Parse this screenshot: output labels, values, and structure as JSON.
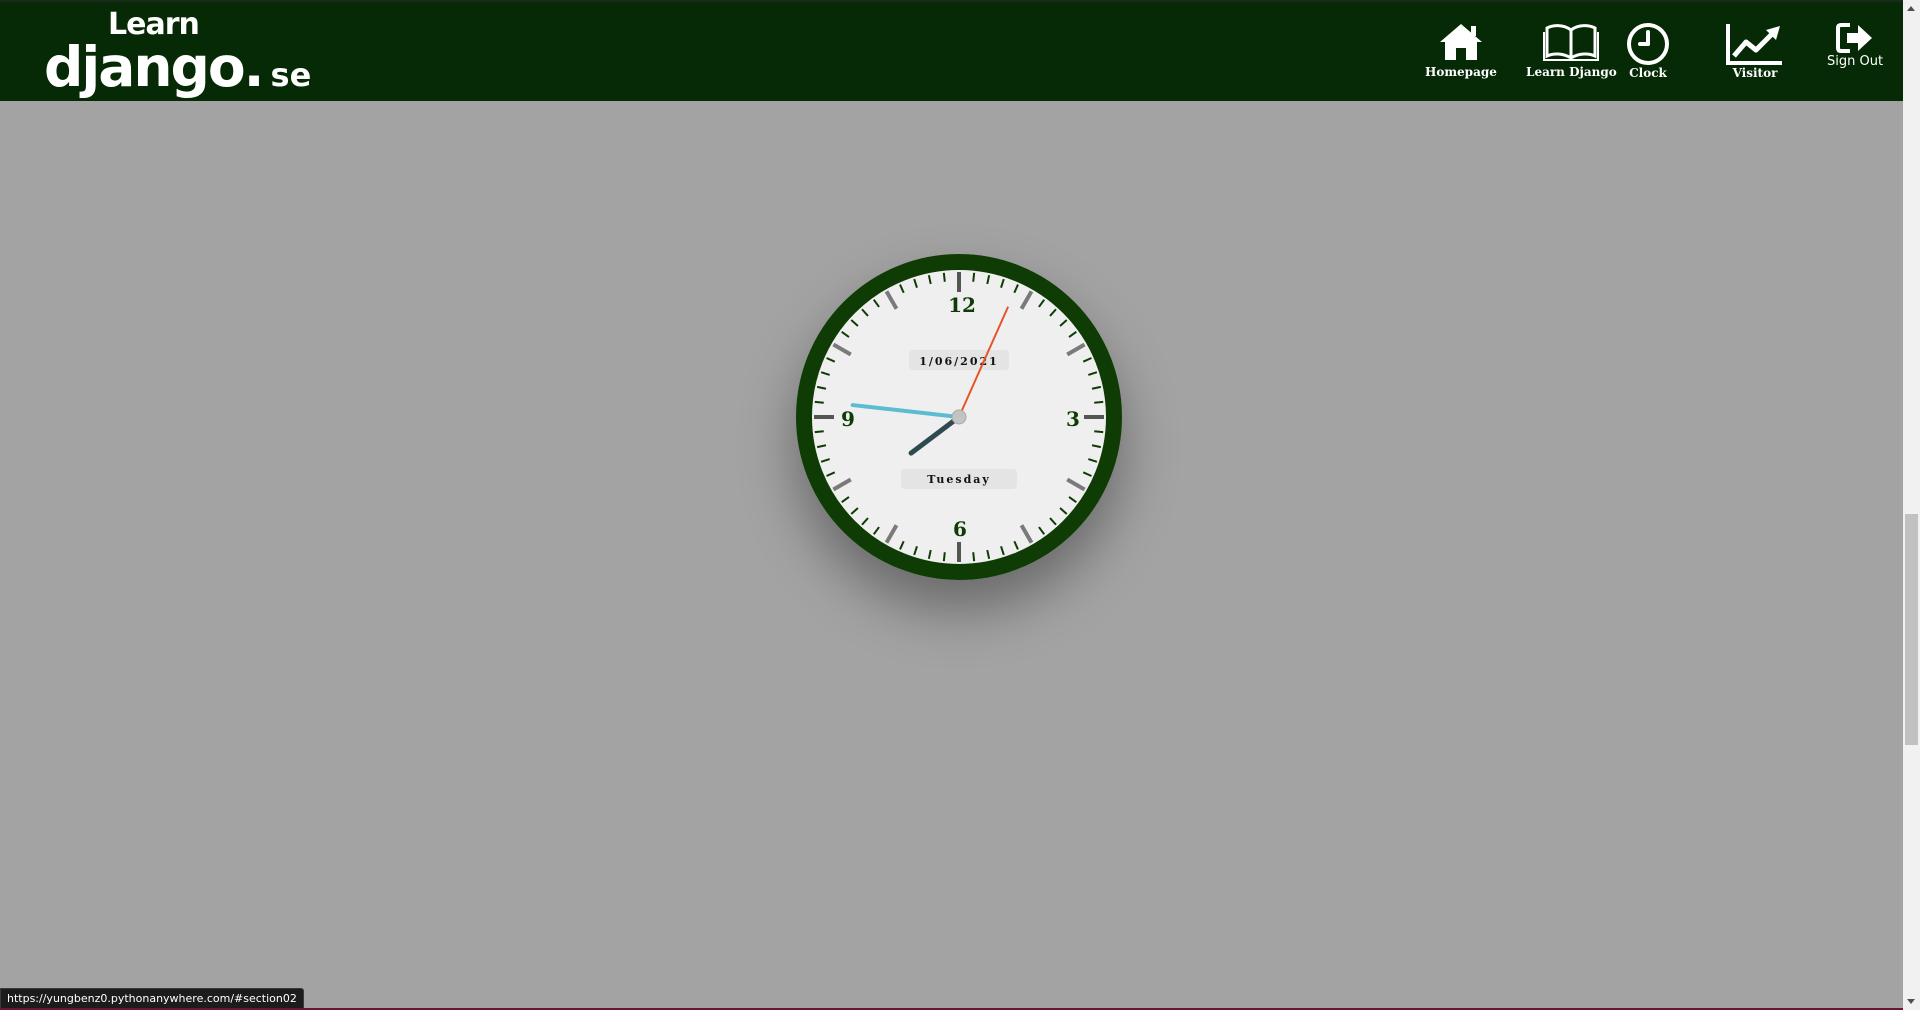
{
  "logo": {
    "line1": "Learn",
    "line2": "django.",
    "suffix": "se"
  },
  "nav": [
    {
      "label": "Homepage",
      "icon": "home-icon"
    },
    {
      "label": "Learn Django",
      "icon": "book-icon"
    },
    {
      "label": "Clock",
      "icon": "clock-icon"
    },
    {
      "label": "Visitor",
      "icon": "trend-chart-icon"
    },
    {
      "label": "Sign Out",
      "icon": "sign-out-icon"
    }
  ],
  "clock": {
    "numerals": {
      "n12": "12",
      "n3": "3",
      "n6": "6",
      "n9": "9"
    },
    "date": "1/06/2021",
    "day": "Tuesday",
    "time": {
      "hours": 7,
      "minutes": 46,
      "seconds": 4
    }
  },
  "status_bar": {
    "url": "https://yungbenz0.pythonanywhere.com/#section02"
  },
  "colors": {
    "navbar": "#052a05",
    "background": "#a3a3a3",
    "clock_ring": "#0f3b04",
    "clock_face": "#efefef",
    "hour_hand": "#2f4a4f",
    "minute_hand": "#5bbcd2",
    "second_hand": "#e8542a"
  }
}
